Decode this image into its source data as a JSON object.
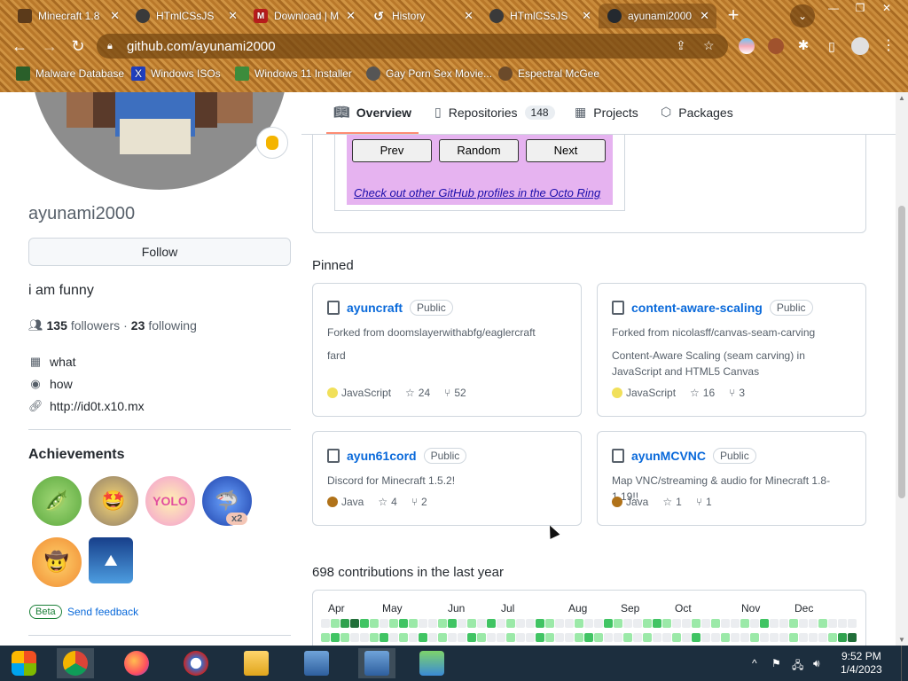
{
  "browser": {
    "tabs": [
      {
        "title": "Minecraft 1.8",
        "favicon_color": "#5b3a1a"
      },
      {
        "title": "HTmlCSsJS",
        "favicon_color": "#3a3a3a"
      },
      {
        "title": "Download | M",
        "favicon_color": "#b71c1c"
      },
      {
        "title": "History",
        "favicon_color": "#5f6368"
      },
      {
        "title": "HTmlCSsJS",
        "favicon_color": "#3a3a3a"
      },
      {
        "title": "ayunami2000",
        "favicon_color": "#24292f"
      }
    ],
    "url": "github.com/ayunami2000",
    "bookmarks": [
      {
        "label": "Malware Database",
        "color": "#2a5f2a"
      },
      {
        "label": "Windows ISOs",
        "color": "#1f3fbf"
      },
      {
        "label": "Windows 11 Installer",
        "color": "#3c8c3c"
      },
      {
        "label": "Gay Porn Sex Movie...",
        "color": "#555555"
      },
      {
        "label": "Espectral McGee",
        "color": "#6b4a2a"
      }
    ]
  },
  "profile": {
    "username": "ayunami2000",
    "follow_label": "Follow",
    "bio": "i am funny",
    "followers": "135",
    "followers_label": "followers",
    "separator": "·",
    "following": "23",
    "following_label": "following",
    "company": "what",
    "location": "how",
    "website": "http://id0t.x10.mx",
    "achievements_title": "Achievements",
    "achievement_badges": [
      "pea-pod",
      "starstruck-cat",
      "yolo",
      "shark-pull",
      "cowboy",
      "arctic-code-vault"
    ],
    "x2_label": "x2",
    "beta_label": "Beta",
    "feedback_label": "Send feedback"
  },
  "nav": {
    "overview": "Overview",
    "repositories": "Repositories",
    "repositories_count": "148",
    "projects": "Projects",
    "packages": "Packages"
  },
  "readme": {
    "prev": "Prev",
    "random": "Random",
    "next": "Next",
    "octo_link": "Check out other GitHub profiles in the Octo Ring"
  },
  "pinned": {
    "title": "Pinned",
    "repos": [
      {
        "name": "ayuncraft",
        "visibility": "Public",
        "line1": "Forked from doomslayerwithabfg/eaglercraft",
        "line2": "fard",
        "language": "JavaScript",
        "lang_color": "#f1e05a",
        "stars": "24",
        "forks": "52"
      },
      {
        "name": "content-aware-scaling",
        "visibility": "Public",
        "line1": "Forked from nicolasff/canvas-seam-carving",
        "line2": "Content-Aware Scaling (seam carving) in JavaScript and HTML5 Canvas",
        "language": "JavaScript",
        "lang_color": "#f1e05a",
        "stars": "16",
        "forks": "3"
      },
      {
        "name": "ayun61cord",
        "visibility": "Public",
        "line1": "Discord for Minecraft 1.5.2!",
        "line2": "",
        "language": "Java",
        "lang_color": "#b07219",
        "stars": "4",
        "forks": "2"
      },
      {
        "name": "ayunMCVNC",
        "visibility": "Public",
        "line1": "Map VNC/streaming & audio for Minecraft 1.8-1.19!!",
        "line2": "",
        "language": "Java",
        "lang_color": "#b07219",
        "stars": "1",
        "forks": "1"
      }
    ]
  },
  "contributions": {
    "title": "698 contributions in the last year",
    "months": [
      "Apr",
      "May",
      "Jun",
      "Jul",
      "Aug",
      "Sep",
      "Oct",
      "Nov",
      "Dec"
    ]
  },
  "taskbar": {
    "time": "9:52 PM",
    "date": "1/4/2023"
  }
}
